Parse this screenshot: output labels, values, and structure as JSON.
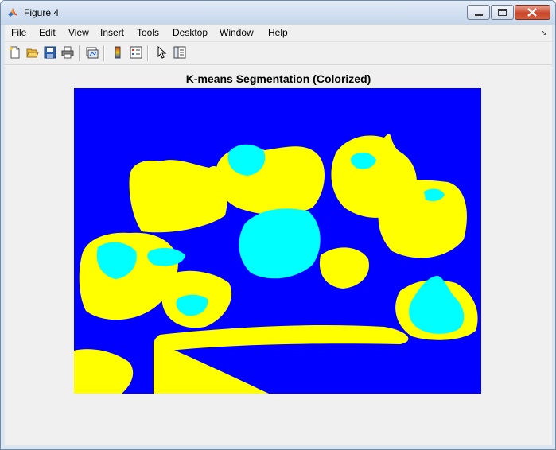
{
  "window": {
    "title": "Figure 4",
    "controls": [
      "minimize",
      "maximize",
      "close"
    ]
  },
  "menubar": {
    "items": [
      "File",
      "Edit",
      "View",
      "Insert",
      "Tools",
      "Desktop",
      "Window",
      "Help"
    ]
  },
  "toolbar": {
    "buttons": [
      {
        "icon": "new-figure-icon"
      },
      {
        "icon": "open-file-icon"
      },
      {
        "icon": "save-icon"
      },
      {
        "icon": "print-icon"
      },
      {
        "icon": "link-plot-icon"
      },
      {
        "icon": "colorbar-icon"
      },
      {
        "icon": "legend-icon"
      },
      {
        "icon": "edit-plot-arrow-icon"
      },
      {
        "icon": "plot-tools-icon"
      }
    ]
  },
  "figure": {
    "title": "K-means Segmentation (Colorized)",
    "colors": {
      "background_cluster": "#0000ff",
      "cluster_2": "#ffff00",
      "cluster_3": "#00ffff"
    }
  }
}
